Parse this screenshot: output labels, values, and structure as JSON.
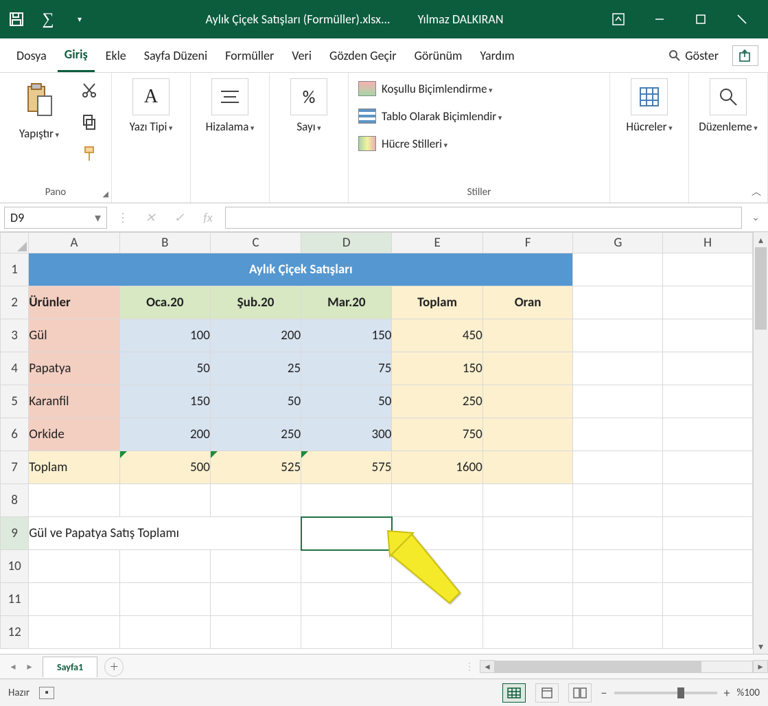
{
  "titlebar": {
    "filename": "Aylık Çiçek Satışları (Formüller).xlsx...",
    "username": "Yılmaz DALKIRAN"
  },
  "ribbon": {
    "tabs": [
      "Dosya",
      "Giriş",
      "Ekle",
      "Sayfa Düzeni",
      "Formüller",
      "Veri",
      "Gözden Geçir",
      "Görünüm",
      "Yardım"
    ],
    "active_tab": "Giriş",
    "search_label": "Göster",
    "groups": {
      "paste_label": "Yapıştır",
      "clipboard_label": "Pano",
      "font_label": "Yazı Tipi",
      "alignment_label": "Hizalama",
      "number_label": "Sayı",
      "styles_label": "Stiller",
      "conditional_label": "Koşullu Biçimlendirme",
      "table_format_label": "Tablo Olarak Biçimlendir",
      "cell_styles_label": "Hücre Stilleri",
      "cells_label": "Hücreler",
      "editing_label": "Düzenleme"
    }
  },
  "fxbar": {
    "namebox": "D9",
    "formula": ""
  },
  "columns": [
    "A",
    "B",
    "C",
    "D",
    "E",
    "F",
    "G",
    "H"
  ],
  "rows": [
    "1",
    "2",
    "3",
    "4",
    "5",
    "6",
    "7",
    "8",
    "9",
    "10",
    "11",
    "12"
  ],
  "sheet": {
    "title_merged": "Aylık Çiçek Satışları",
    "headers": {
      "A": "Ürünler",
      "B": "Oca.20",
      "C": "Şub.20",
      "D": "Mar.20",
      "E": "Toplam",
      "F": "Oran"
    },
    "products": [
      "Gül",
      "Papatya",
      "Karanfil",
      "Orkide"
    ],
    "data": {
      "Gül": {
        "B": "100",
        "C": "200",
        "D": "150",
        "E": "450"
      },
      "Papatya": {
        "B": "50",
        "C": "25",
        "D": "75",
        "E": "150"
      },
      "Karanfil": {
        "B": "150",
        "C": "50",
        "D": "50",
        "E": "250"
      },
      "Orkide": {
        "B": "200",
        "C": "250",
        "D": "300",
        "E": "750"
      }
    },
    "totals_row": {
      "label": "Toplam",
      "B": "500",
      "C": "525",
      "D": "575",
      "E": "1600"
    },
    "note_row9": "Gül ve Papatya Satış Toplamı"
  },
  "sheet_tabs": {
    "active": "Sayfa1"
  },
  "statusbar": {
    "ready": "Hazır",
    "zoom": "%100"
  }
}
